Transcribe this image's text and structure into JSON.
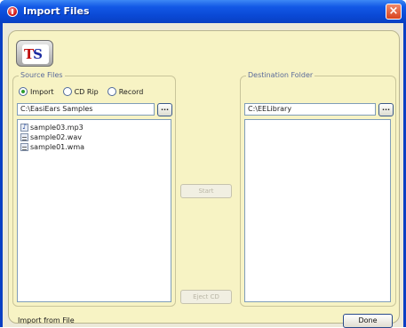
{
  "window": {
    "title": "Import Files"
  },
  "logo": {
    "text_left": "T",
    "text_right": "S"
  },
  "source": {
    "group_label": "Source Files",
    "radios": [
      {
        "label": "Import",
        "selected": true
      },
      {
        "label": "CD Rip",
        "selected": false
      },
      {
        "label": "Record",
        "selected": false
      }
    ],
    "path": "C:\\EasiEars Samples",
    "browse_label": "...",
    "files": [
      {
        "name": "sample03.mp3",
        "icon": "music-file-icon"
      },
      {
        "name": "sample02.wav",
        "icon": "audio-file-icon"
      },
      {
        "name": "sample01.wma",
        "icon": "audio-file-icon"
      }
    ]
  },
  "destination": {
    "group_label": "Destination Folder",
    "path": "C:\\EELibrary",
    "browse_label": "..."
  },
  "buttons": {
    "start": "Start",
    "eject": "Eject CD",
    "done": "Done"
  },
  "status": "Import from File"
}
